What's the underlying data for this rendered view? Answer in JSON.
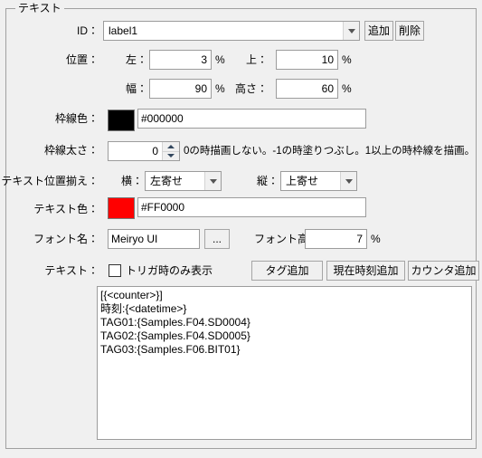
{
  "group": {
    "title": "テキスト"
  },
  "id_row": {
    "label": "ID：",
    "value": "label1",
    "add_button": "追加",
    "delete_button": "削除"
  },
  "position_row": {
    "label": "位置：",
    "left_label": "左：",
    "left_value": "3",
    "left_unit": "%",
    "top_label": "上：",
    "top_value": "10",
    "top_unit": "%",
    "width_label": "幅：",
    "width_value": "90",
    "width_unit": "%",
    "height_label": "高さ：",
    "height_value": "60",
    "height_unit": "%"
  },
  "border_color_row": {
    "label": "枠線色：",
    "swatch_color": "#000000",
    "value": "#000000"
  },
  "border_width_row": {
    "label": "枠線太さ：",
    "value": "0",
    "hint": "0の時描画しない。-1の時塗りつぶし。1以上の時枠線を描画。"
  },
  "align_row": {
    "label": "テキスト位置揃え：",
    "horizontal_label": "横：",
    "horizontal_value": "左寄せ",
    "vertical_label": "縦：",
    "vertical_value": "上寄せ"
  },
  "text_color_row": {
    "label": "テキスト色：",
    "swatch_color": "#FF0000",
    "value": "#FF0000"
  },
  "font_row": {
    "label": "フォント名：",
    "value": "Meiryo UI",
    "browse_button": "...",
    "height_label": "フォント高さ：",
    "height_value": "7",
    "height_unit": "%"
  },
  "text_row": {
    "label": "テキスト：",
    "checkbox_label": "トリガ時のみ表示",
    "checkbox_checked": false,
    "tag_button": "タグ追加",
    "datetime_button": "現在時刻追加",
    "counter_button": "カウンタ追加"
  },
  "textarea": {
    "value": "[{<counter>}]\n時刻:{<datetime>}\nTAG01:{Samples.F04.SD0004}\nTAG02:{Samples.F04.SD0005}\nTAG03:{Samples.F06.BIT01}"
  },
  "colors": {
    "window_bg": "#f0f0f0",
    "field_bg": "#ffffff",
    "border": "#9c9c9c",
    "group_border": "#a0a0a0",
    "text": "#000000",
    "accent_red": "#FF0000"
  }
}
